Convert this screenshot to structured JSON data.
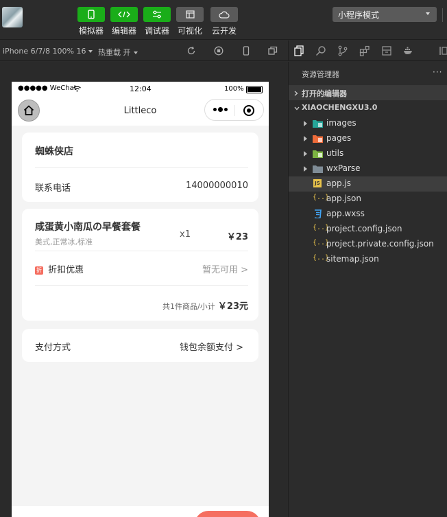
{
  "toolbar": {
    "buttons": [
      {
        "label": "模拟器",
        "style": "green"
      },
      {
        "label": "编辑器",
        "style": "green"
      },
      {
        "label": "调试器",
        "style": "green"
      },
      {
        "label": "可视化",
        "style": "gray"
      },
      {
        "label": "云开发",
        "style": "gray"
      }
    ],
    "mode": "小程序模式"
  },
  "simbar": {
    "device": "iPhone 6/7/8 100% 16",
    "hot_reload": "热重载 开"
  },
  "phone": {
    "status": {
      "carrier": "●●●●● WeChat",
      "time": "12:04",
      "battery": "100%"
    },
    "nav_title": "Littleco",
    "shop": {
      "name": "蜘蛛侠店",
      "phone_label": "联系电话",
      "phone_value": "14000000010"
    },
    "order": {
      "item_name": "咸蛋黄小南瓜の早餐套餐",
      "item_spec": "美式,正常冰,标准",
      "quantity": "x1",
      "price": "￥23",
      "discount_label": "折扣优惠",
      "discount_badge": "折",
      "discount_value": "暂无可用 >",
      "summary_text": "共1件商品/小计",
      "summary_total": "￥23元"
    },
    "payment": {
      "label": "支付方式",
      "value": "钱包余额支付 >"
    }
  },
  "explorer": {
    "title": "资源管理器",
    "more": "···",
    "open_editors": "打开的编辑器",
    "project": "XIAOCHENGXU3.0",
    "folders": [
      "images",
      "pages",
      "utils",
      "wxParse"
    ],
    "files": [
      "app.js",
      "app.json",
      "app.wxss",
      "project.config.json",
      "project.private.config.json",
      "sitemap.json"
    ]
  },
  "colors": {
    "accent_green": "#1aad19",
    "pay_button": "#f56e60",
    "folder_gray": "#7f8c96",
    "json_yellow": "#e8c34b",
    "wxss_blue": "#42a5f5"
  }
}
